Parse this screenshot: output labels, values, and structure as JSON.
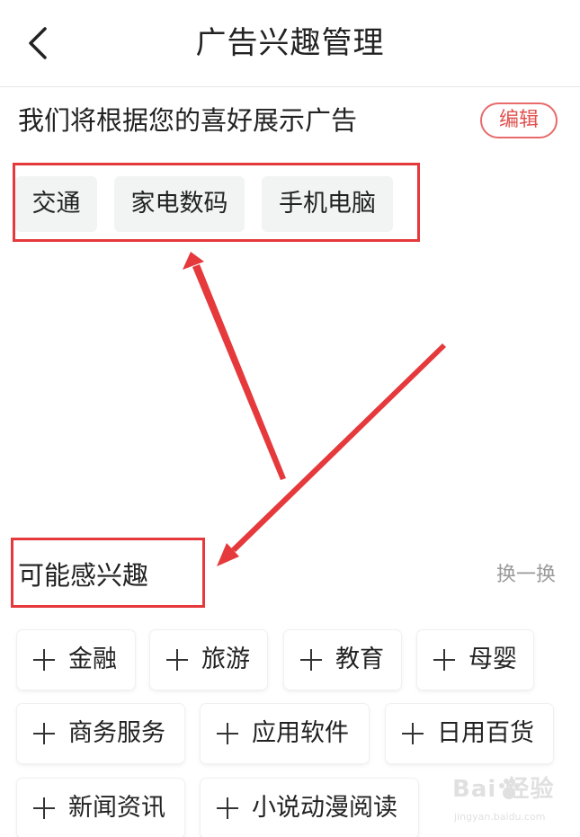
{
  "header": {
    "back_icon": "chevron-left-icon",
    "title": "广告兴趣管理"
  },
  "interests": {
    "title": "我们将根据您的喜好展示广告",
    "edit_label": "编辑",
    "tags": [
      {
        "label": "交通"
      },
      {
        "label": "家电数码"
      },
      {
        "label": "手机电脑"
      }
    ]
  },
  "suggestions": {
    "title": "可能感兴趣",
    "refresh_label": "换一换",
    "tags": [
      {
        "label": "金融"
      },
      {
        "label": "旅游"
      },
      {
        "label": "教育"
      },
      {
        "label": "母婴"
      },
      {
        "label": "商务服务"
      },
      {
        "label": "应用软件"
      },
      {
        "label": "日用百货"
      },
      {
        "label": "新闻资讯"
      },
      {
        "label": "小说动漫阅读"
      }
    ]
  },
  "annotation": {
    "color": "#e5393c"
  },
  "watermark": {
    "text": "Bai 经验",
    "url": "jingyan.baidu.com"
  }
}
